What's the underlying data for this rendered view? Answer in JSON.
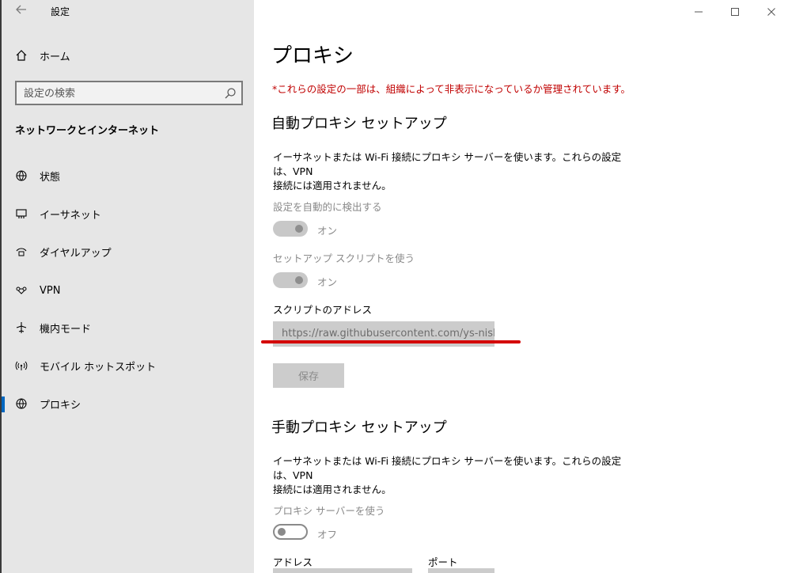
{
  "window": {
    "title": "設定",
    "controls": [
      "minimize",
      "maximize",
      "close"
    ]
  },
  "sidebar": {
    "home_label": "ホーム",
    "search_placeholder": "設定の検索",
    "section_title": "ネットワークとインターネット",
    "items": [
      {
        "label": "状態",
        "icon": "globe-status-icon"
      },
      {
        "label": "イーサネット",
        "icon": "ethernet-icon"
      },
      {
        "label": "ダイヤルアップ",
        "icon": "dialup-icon"
      },
      {
        "label": "VPN",
        "icon": "vpn-icon"
      },
      {
        "label": "機内モード",
        "icon": "airplane-icon"
      },
      {
        "label": "モバイル ホットスポット",
        "icon": "hotspot-icon"
      },
      {
        "label": "プロキシ",
        "icon": "globe-icon",
        "active": true
      }
    ]
  },
  "main": {
    "title": "プロキシ",
    "warning": "*これらの設定の一部は、組織によって非表示になっているか管理されています。",
    "auto": {
      "heading": "自動プロキシ セットアップ",
      "desc_line1": "イーサネットまたは Wi-Fi 接続にプロキシ サーバーを使います。これらの設定は、VPN",
      "desc_line2": "接続には適用されません。",
      "detect_label": "設定を自動的に検出する",
      "detect_state": "オン",
      "script_label": "セットアップ スクリプトを使う",
      "script_state": "オン",
      "address_label": "スクリプトのアドレス",
      "address_value": "https://raw.githubusercontent.com/ys-nish",
      "save_label": "保存"
    },
    "manual": {
      "heading": "手動プロキシ セットアップ",
      "desc_line1": "イーサネットまたは Wi-Fi 接続にプロキシ サーバーを使います。これらの設定は、VPN",
      "desc_line2": "接続には適用されません。",
      "use_label": "プロキシ サーバーを使う",
      "use_state": "オフ",
      "address_label": "アドレス",
      "port_label": "ポート"
    }
  },
  "colors": {
    "accent": "#0067c0",
    "warning": "#c00000",
    "annotation": "#d40000"
  }
}
